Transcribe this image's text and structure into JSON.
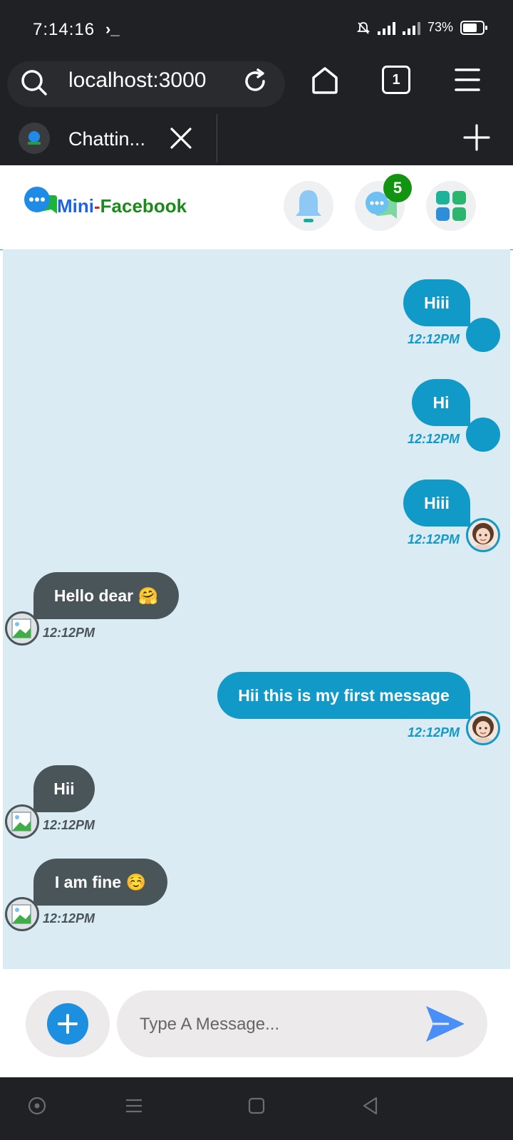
{
  "status_bar": {
    "time": "7:14:16",
    "terminal_glyph": "›_",
    "battery": "73%"
  },
  "browser": {
    "url": "localhost:3000",
    "tab_count": "1"
  },
  "tab": {
    "title": "Chattin..."
  },
  "app": {
    "logo_mini": "Mini",
    "logo_dash": "-",
    "logo_facebook": "Facebook",
    "message_badge": "5"
  },
  "messages": [
    {
      "direction": "out",
      "text": "Hiii",
      "time": "12:12PM",
      "avatar": "blank"
    },
    {
      "direction": "out",
      "text": "Hi",
      "time": "12:12PM",
      "avatar": "blank"
    },
    {
      "direction": "out",
      "text": "Hiii",
      "time": "12:12PM",
      "avatar": "girl"
    },
    {
      "direction": "in",
      "text": "Hello dear 🤗",
      "time": "12:12PM",
      "avatar": "broken"
    },
    {
      "direction": "out",
      "text": "Hii this is my first message",
      "time": "12:12PM",
      "avatar": "girl"
    },
    {
      "direction": "in",
      "text": "Hii",
      "time": "12:12PM",
      "avatar": "broken"
    },
    {
      "direction": "in",
      "text": "I am fine ☺️",
      "time": "12:12PM",
      "avatar": "broken"
    }
  ],
  "composer": {
    "placeholder": "Type A Message..."
  },
  "colors": {
    "outgoing": "#1199c8",
    "incoming": "#4a5559",
    "chat_bg": "#dbebf3"
  }
}
